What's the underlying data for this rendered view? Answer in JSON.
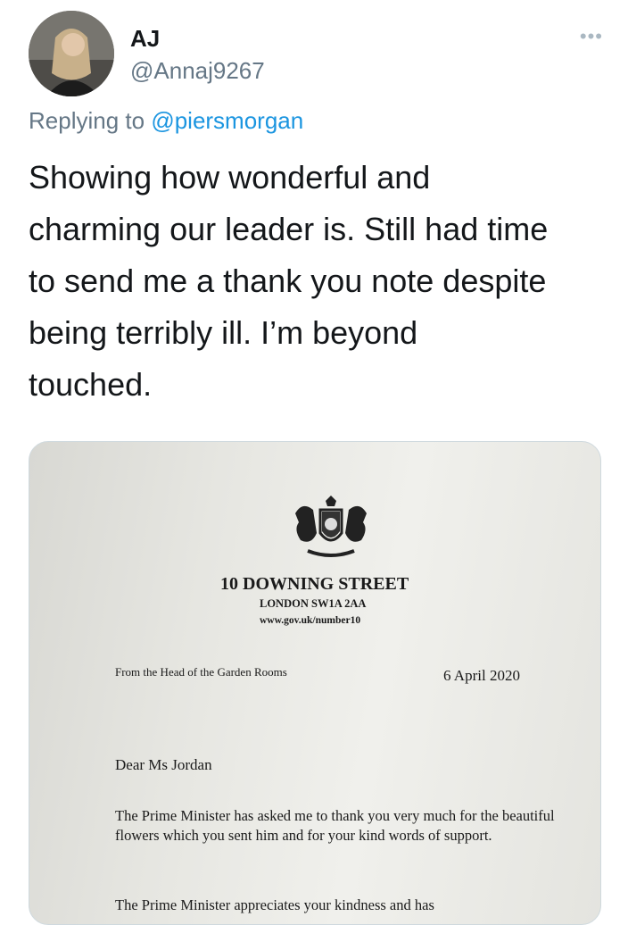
{
  "tweet": {
    "display_name": "AJ",
    "handle": "@Annaj9267",
    "more_icon": "more-horizontal-icon",
    "reply_prefix": "Replying to",
    "reply_to": "@piersmorgan",
    "text": "Showing how wonderful and\ncharming our leader is.  Still had time\nto send me a thank you note despite\nbeing terribly ill.  I’m beyond\ntouched."
  },
  "letter": {
    "crest_icon": "royal-coat-of-arms-icon",
    "office": "10 DOWNING STREET",
    "address": "LONDON SW1A 2AA",
    "website": "www.gov.uk/number10",
    "from": "From the Head of the Garden Rooms",
    "date": "6 April 2020",
    "salutation": "Dear Ms Jordan",
    "paragraph1": "The Prime Minister has asked me to thank you very much for the beautiful flowers which you sent him and for your kind words of support.",
    "paragraph2": "The Prime Minister appreciates your kindness and has"
  },
  "colors": {
    "text": "#14171a",
    "secondary": "#657786",
    "link": "#1b95e0"
  }
}
